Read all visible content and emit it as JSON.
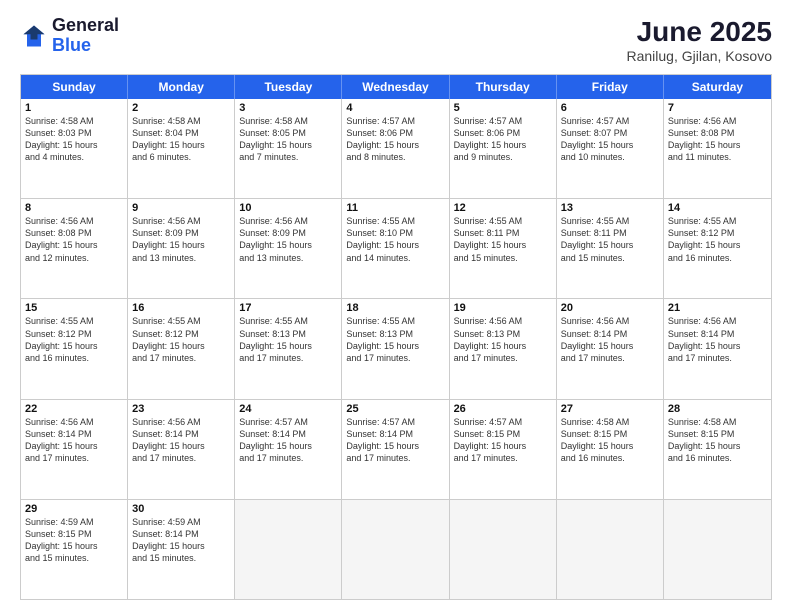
{
  "header": {
    "logo_general": "General",
    "logo_blue": "Blue",
    "title": "June 2025",
    "subtitle": "Ranilug, Gjilan, Kosovo"
  },
  "calendar": {
    "days": [
      "Sunday",
      "Monday",
      "Tuesday",
      "Wednesday",
      "Thursday",
      "Friday",
      "Saturday"
    ],
    "rows": [
      [
        {
          "day": "1",
          "lines": [
            "Sunrise: 4:58 AM",
            "Sunset: 8:03 PM",
            "Daylight: 15 hours",
            "and 4 minutes."
          ]
        },
        {
          "day": "2",
          "lines": [
            "Sunrise: 4:58 AM",
            "Sunset: 8:04 PM",
            "Daylight: 15 hours",
            "and 6 minutes."
          ]
        },
        {
          "day": "3",
          "lines": [
            "Sunrise: 4:58 AM",
            "Sunset: 8:05 PM",
            "Daylight: 15 hours",
            "and 7 minutes."
          ]
        },
        {
          "day": "4",
          "lines": [
            "Sunrise: 4:57 AM",
            "Sunset: 8:06 PM",
            "Daylight: 15 hours",
            "and 8 minutes."
          ]
        },
        {
          "day": "5",
          "lines": [
            "Sunrise: 4:57 AM",
            "Sunset: 8:06 PM",
            "Daylight: 15 hours",
            "and 9 minutes."
          ]
        },
        {
          "day": "6",
          "lines": [
            "Sunrise: 4:57 AM",
            "Sunset: 8:07 PM",
            "Daylight: 15 hours",
            "and 10 minutes."
          ]
        },
        {
          "day": "7",
          "lines": [
            "Sunrise: 4:56 AM",
            "Sunset: 8:08 PM",
            "Daylight: 15 hours",
            "and 11 minutes."
          ]
        }
      ],
      [
        {
          "day": "8",
          "lines": [
            "Sunrise: 4:56 AM",
            "Sunset: 8:08 PM",
            "Daylight: 15 hours",
            "and 12 minutes."
          ]
        },
        {
          "day": "9",
          "lines": [
            "Sunrise: 4:56 AM",
            "Sunset: 8:09 PM",
            "Daylight: 15 hours",
            "and 13 minutes."
          ]
        },
        {
          "day": "10",
          "lines": [
            "Sunrise: 4:56 AM",
            "Sunset: 8:09 PM",
            "Daylight: 15 hours",
            "and 13 minutes."
          ]
        },
        {
          "day": "11",
          "lines": [
            "Sunrise: 4:55 AM",
            "Sunset: 8:10 PM",
            "Daylight: 15 hours",
            "and 14 minutes."
          ]
        },
        {
          "day": "12",
          "lines": [
            "Sunrise: 4:55 AM",
            "Sunset: 8:11 PM",
            "Daylight: 15 hours",
            "and 15 minutes."
          ]
        },
        {
          "day": "13",
          "lines": [
            "Sunrise: 4:55 AM",
            "Sunset: 8:11 PM",
            "Daylight: 15 hours",
            "and 15 minutes."
          ]
        },
        {
          "day": "14",
          "lines": [
            "Sunrise: 4:55 AM",
            "Sunset: 8:12 PM",
            "Daylight: 15 hours",
            "and 16 minutes."
          ]
        }
      ],
      [
        {
          "day": "15",
          "lines": [
            "Sunrise: 4:55 AM",
            "Sunset: 8:12 PM",
            "Daylight: 15 hours",
            "and 16 minutes."
          ]
        },
        {
          "day": "16",
          "lines": [
            "Sunrise: 4:55 AM",
            "Sunset: 8:12 PM",
            "Daylight: 15 hours",
            "and 17 minutes."
          ]
        },
        {
          "day": "17",
          "lines": [
            "Sunrise: 4:55 AM",
            "Sunset: 8:13 PM",
            "Daylight: 15 hours",
            "and 17 minutes."
          ]
        },
        {
          "day": "18",
          "lines": [
            "Sunrise: 4:55 AM",
            "Sunset: 8:13 PM",
            "Daylight: 15 hours",
            "and 17 minutes."
          ]
        },
        {
          "day": "19",
          "lines": [
            "Sunrise: 4:56 AM",
            "Sunset: 8:13 PM",
            "Daylight: 15 hours",
            "and 17 minutes."
          ]
        },
        {
          "day": "20",
          "lines": [
            "Sunrise: 4:56 AM",
            "Sunset: 8:14 PM",
            "Daylight: 15 hours",
            "and 17 minutes."
          ]
        },
        {
          "day": "21",
          "lines": [
            "Sunrise: 4:56 AM",
            "Sunset: 8:14 PM",
            "Daylight: 15 hours",
            "and 17 minutes."
          ]
        }
      ],
      [
        {
          "day": "22",
          "lines": [
            "Sunrise: 4:56 AM",
            "Sunset: 8:14 PM",
            "Daylight: 15 hours",
            "and 17 minutes."
          ]
        },
        {
          "day": "23",
          "lines": [
            "Sunrise: 4:56 AM",
            "Sunset: 8:14 PM",
            "Daylight: 15 hours",
            "and 17 minutes."
          ]
        },
        {
          "day": "24",
          "lines": [
            "Sunrise: 4:57 AM",
            "Sunset: 8:14 PM",
            "Daylight: 15 hours",
            "and 17 minutes."
          ]
        },
        {
          "day": "25",
          "lines": [
            "Sunrise: 4:57 AM",
            "Sunset: 8:14 PM",
            "Daylight: 15 hours",
            "and 17 minutes."
          ]
        },
        {
          "day": "26",
          "lines": [
            "Sunrise: 4:57 AM",
            "Sunset: 8:15 PM",
            "Daylight: 15 hours",
            "and 17 minutes."
          ]
        },
        {
          "day": "27",
          "lines": [
            "Sunrise: 4:58 AM",
            "Sunset: 8:15 PM",
            "Daylight: 15 hours",
            "and 16 minutes."
          ]
        },
        {
          "day": "28",
          "lines": [
            "Sunrise: 4:58 AM",
            "Sunset: 8:15 PM",
            "Daylight: 15 hours",
            "and 16 minutes."
          ]
        }
      ],
      [
        {
          "day": "29",
          "lines": [
            "Sunrise: 4:59 AM",
            "Sunset: 8:15 PM",
            "Daylight: 15 hours",
            "and 15 minutes."
          ]
        },
        {
          "day": "30",
          "lines": [
            "Sunrise: 4:59 AM",
            "Sunset: 8:14 PM",
            "Daylight: 15 hours",
            "and 15 minutes."
          ]
        },
        {
          "day": "",
          "lines": [],
          "empty": true
        },
        {
          "day": "",
          "lines": [],
          "empty": true
        },
        {
          "day": "",
          "lines": [],
          "empty": true
        },
        {
          "day": "",
          "lines": [],
          "empty": true
        },
        {
          "day": "",
          "lines": [],
          "empty": true
        }
      ]
    ]
  }
}
